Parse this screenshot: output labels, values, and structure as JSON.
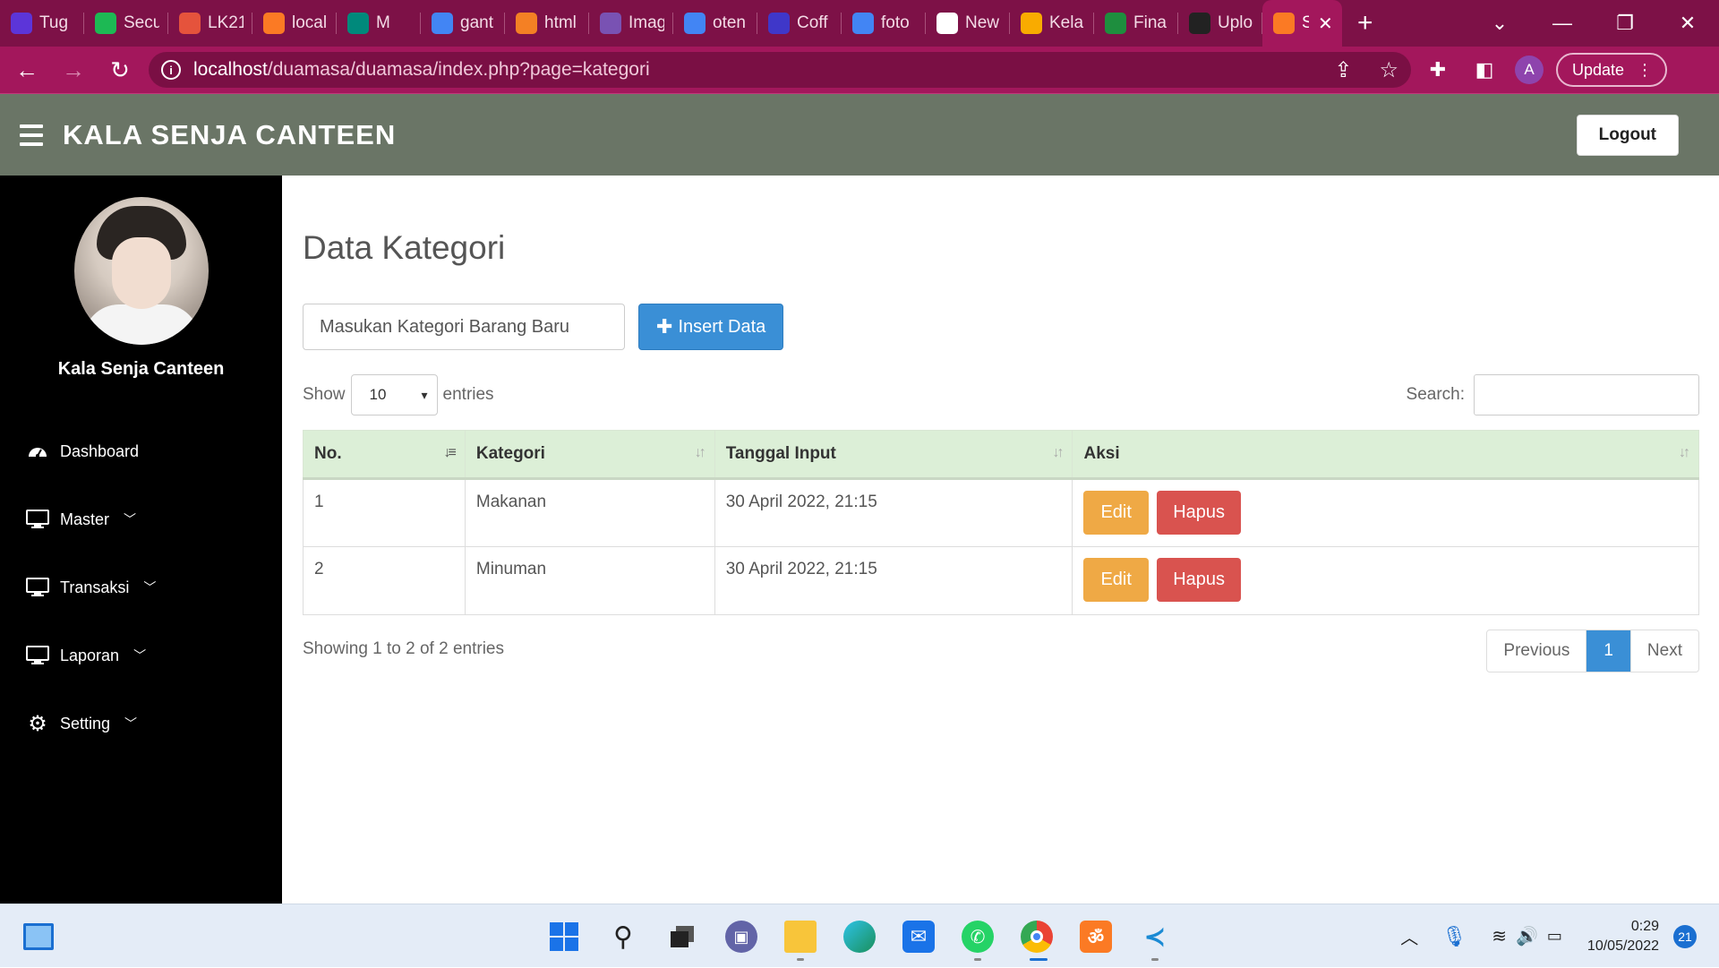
{
  "browser": {
    "tabs": [
      {
        "title": "Tug",
        "icon": "list-icon",
        "color": "#5c35d9"
      },
      {
        "title": "Secu",
        "icon": "spotify-icon",
        "color": "#1db954"
      },
      {
        "title": "LK21",
        "icon": "pinwheel-icon",
        "color": "#e5533c"
      },
      {
        "title": "local",
        "icon": "xampp-mountain-icon",
        "color": "#fb7a24"
      },
      {
        "title": "M",
        "icon": "meet-icon",
        "color": "#00897b"
      },
      {
        "title": "gant",
        "icon": "google-icon",
        "color": "#4285f4"
      },
      {
        "title": "html",
        "icon": "stackoverflow-icon",
        "color": "#f48024"
      },
      {
        "title": "Imag",
        "icon": "bootstrap-icon",
        "color": "#7952b3"
      },
      {
        "title": "oten",
        "icon": "google-icon",
        "color": "#4285f4"
      },
      {
        "title": "Coff",
        "icon": "upwork-icon",
        "color": "#3f37c9"
      },
      {
        "title": "foto",
        "icon": "google-icon",
        "color": "#4285f4"
      },
      {
        "title": "New",
        "icon": "chrome-icon",
        "color": "#ffffff"
      },
      {
        "title": "Kela",
        "icon": "classroom-icon",
        "color": "#f9ab00"
      },
      {
        "title": "Fina",
        "icon": "classroom-icon",
        "color": "#1e8e3e"
      },
      {
        "title": "Uplo",
        "icon": "github-icon",
        "color": "#222222"
      },
      {
        "title": "S",
        "icon": "xampp-icon",
        "color": "#fb7a24"
      }
    ],
    "url_host": "localhost",
    "url_path": "/duamasa/duamasa/index.php?page=kategori",
    "profile_initial": "A",
    "update_label": "Update"
  },
  "header": {
    "brand": "KALA SENJA CANTEEN",
    "logout_label": "Logout"
  },
  "sidebar": {
    "user_name": "Kala Senja Canteen",
    "items": [
      {
        "label": "Dashboard",
        "icon": "dashboard-icon",
        "has_submenu": false
      },
      {
        "label": "Master",
        "icon": "monitor-icon",
        "has_submenu": true
      },
      {
        "label": "Transaksi",
        "icon": "monitor-icon",
        "has_submenu": true
      },
      {
        "label": "Laporan",
        "icon": "monitor-icon",
        "has_submenu": true
      },
      {
        "label": "Setting",
        "icon": "gear-icon",
        "has_submenu": true
      }
    ]
  },
  "main": {
    "title": "Data Kategori",
    "input_placeholder": "Masukan Kategori Barang Baru",
    "insert_label": "Insert Data",
    "show_label": "Show",
    "entries_value": "10",
    "entries_label": "entries",
    "search_label": "Search:",
    "columns": [
      "No.",
      "Kategori",
      "Tanggal Input",
      "Aksi"
    ],
    "rows": [
      {
        "no": "1",
        "kategori": "Makanan",
        "tanggal": "30 April 2022, 21:15"
      },
      {
        "no": "2",
        "kategori": "Minuman",
        "tanggal": "30 April 2022, 21:15"
      }
    ],
    "edit_label": "Edit",
    "hapus_label": "Hapus",
    "info": "Showing 1 to 2 of 2 entries",
    "pager": {
      "previous": "Previous",
      "current": "1",
      "next": "Next"
    }
  },
  "taskbar": {
    "time": "0:29",
    "date": "10/05/2022",
    "notifications": "21"
  }
}
